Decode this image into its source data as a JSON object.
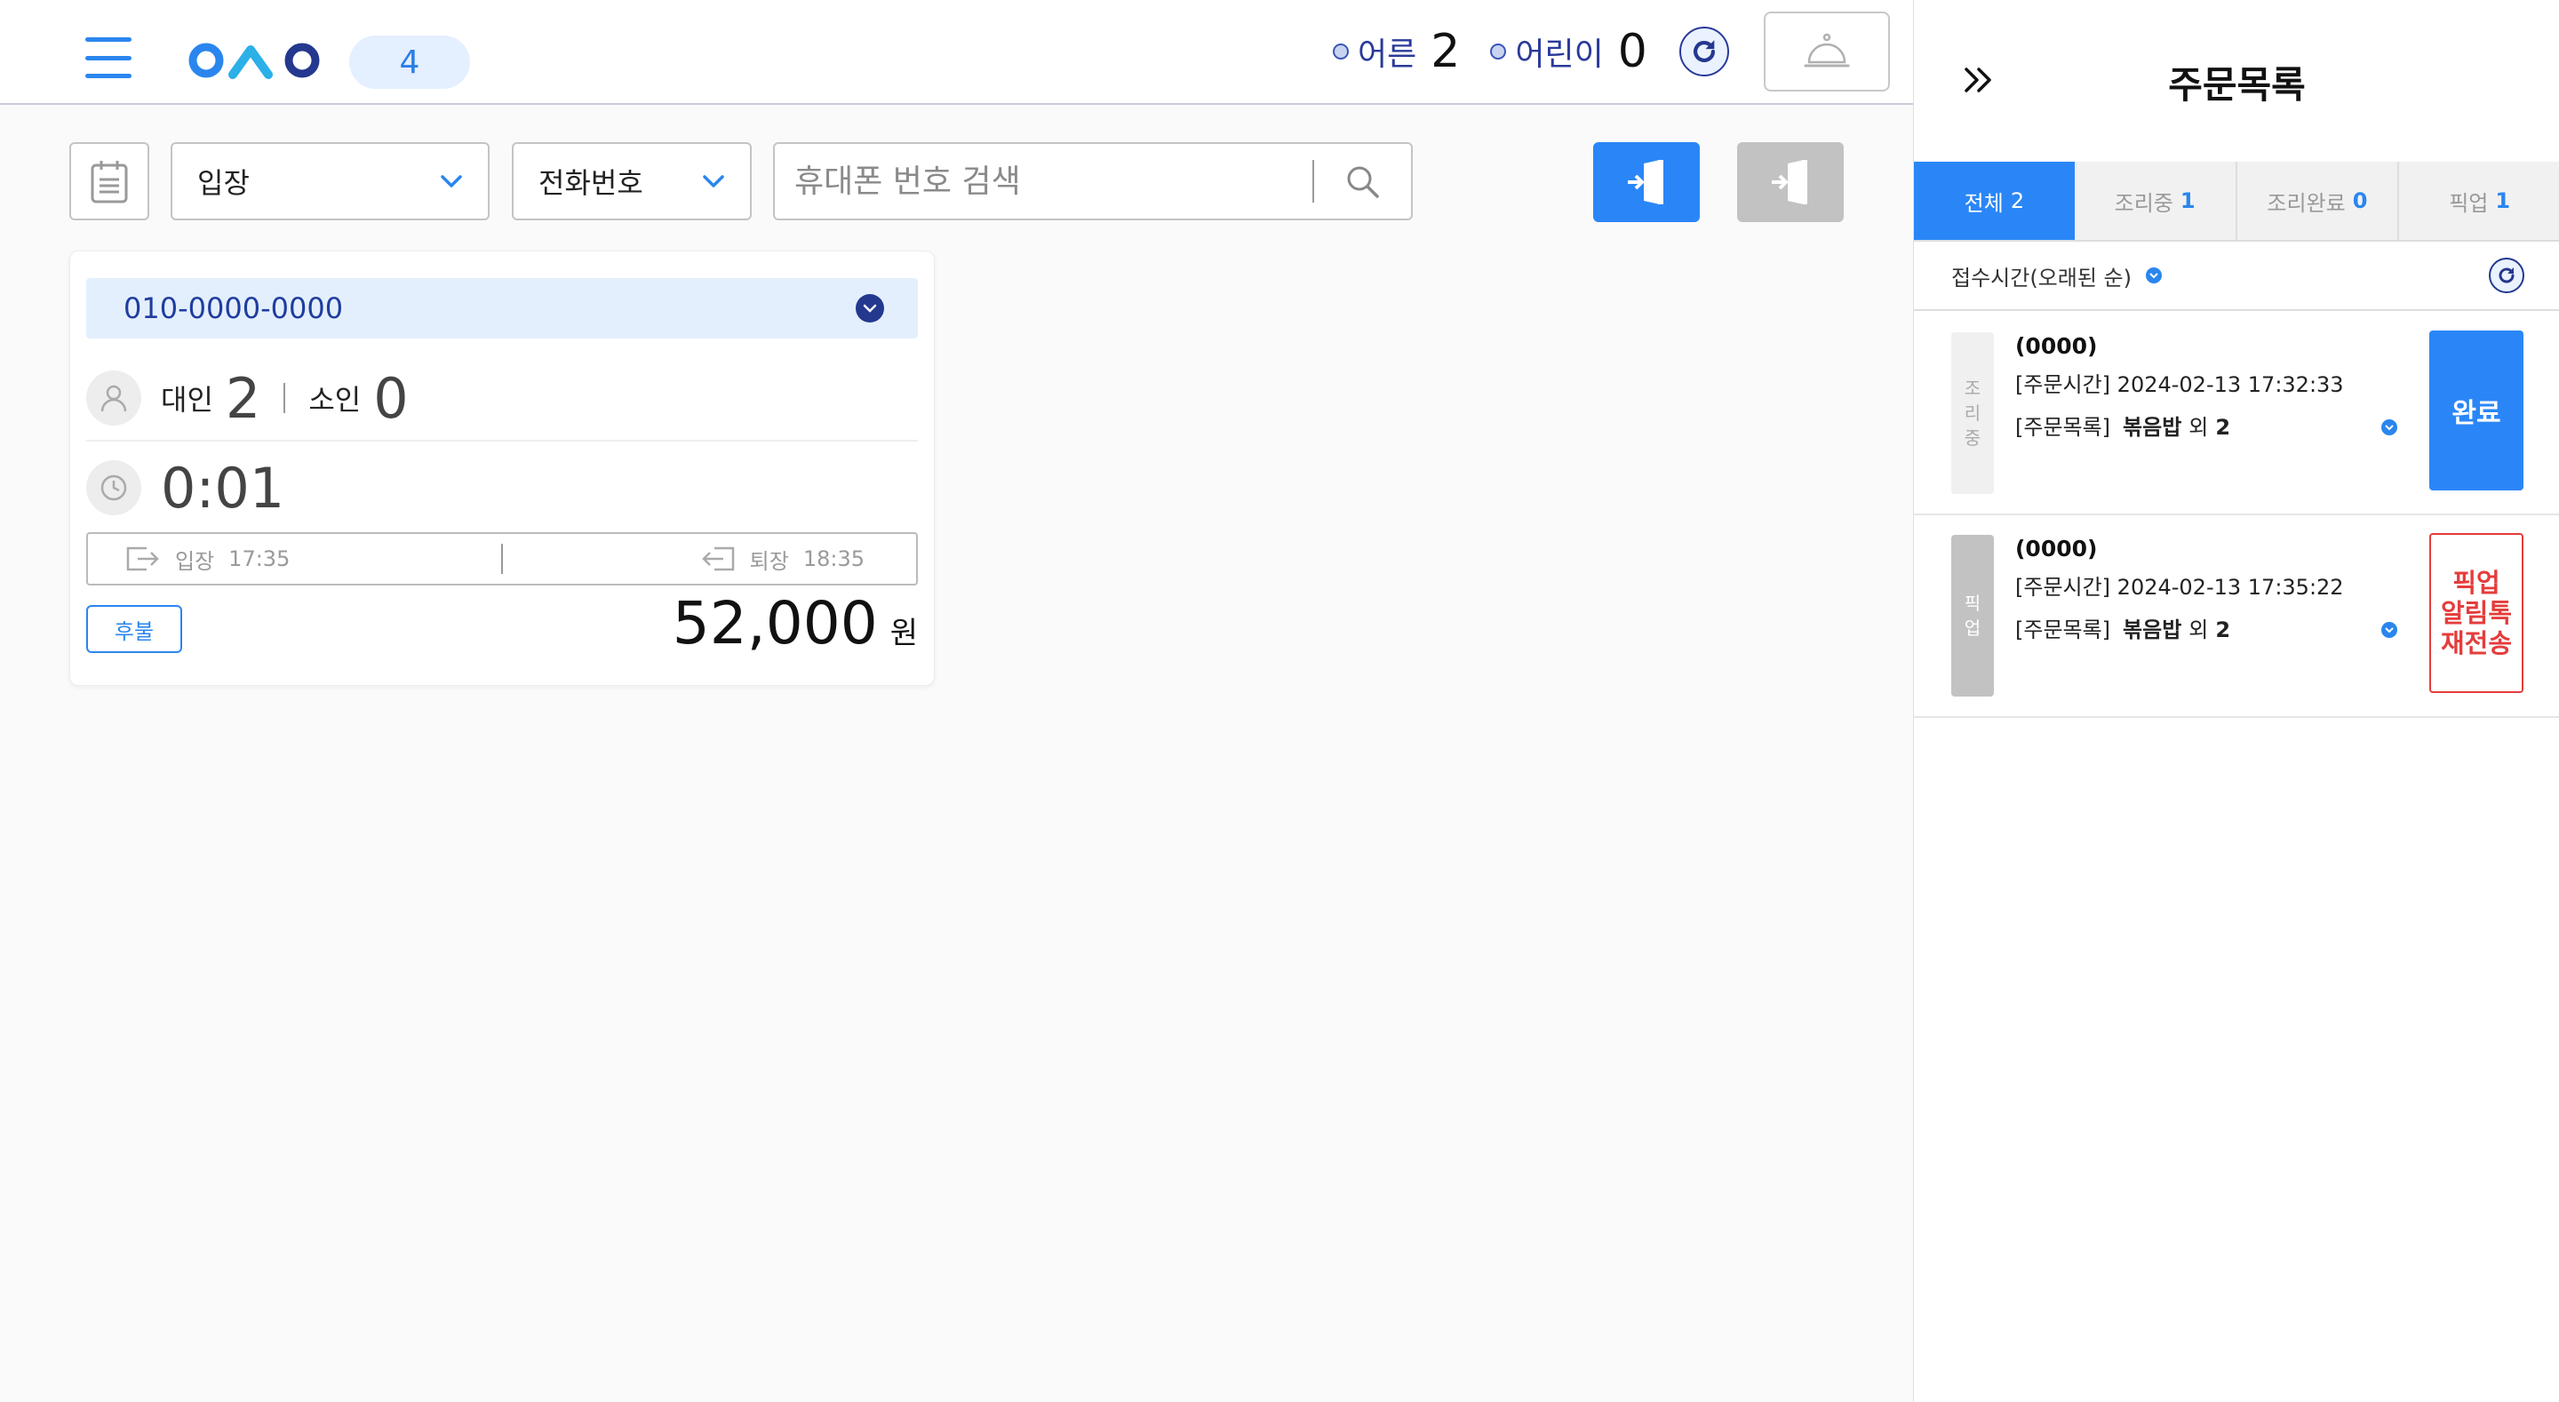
{
  "header": {
    "badge_count": "4",
    "adult_label": "어른",
    "adult_count": "2",
    "child_label": "어린이",
    "child_count": "0"
  },
  "toolbar": {
    "entry_select": "입장",
    "phone_select": "전화번호",
    "search_placeholder": "휴대폰 번호 검색"
  },
  "card": {
    "phone": "010-0000-0000",
    "adult_label": "대인",
    "adult_count": "2",
    "child_label": "소인",
    "child_count": "0",
    "elapsed": "0:01",
    "entry_label": "입장",
    "entry_time": "17:35",
    "exit_label": "퇴장",
    "exit_time": "18:35",
    "payment_badge": "후불",
    "amount": "52,000",
    "amount_unit": "원"
  },
  "panel": {
    "title": "주문목록",
    "tabs": [
      {
        "label": "전체",
        "count": "2"
      },
      {
        "label": "조리중",
        "count": "1"
      },
      {
        "label": "조리완료",
        "count": "0"
      },
      {
        "label": "픽업",
        "count": "1"
      }
    ],
    "sort_label": "접수시간(오래된 순)",
    "orders": [
      {
        "status": [
          "조",
          "리",
          "중"
        ],
        "id": "(0000)",
        "time": "[주문시간] 2024-02-13 17:32:33",
        "menu_prefix": "[주문목록]",
        "menu_item": "볶음밥",
        "menu_more": "외",
        "menu_count": "2",
        "action": "완료"
      },
      {
        "status": [
          "픽",
          "업"
        ],
        "id": "(0000)",
        "time": "[주문시간] 2024-02-13 17:35:22",
        "menu_prefix": "[주문목록]",
        "menu_item": "볶음밥",
        "menu_more": "외",
        "menu_count": "2",
        "action_lines": [
          "픽업",
          "알림톡",
          "재전송"
        ]
      }
    ]
  },
  "colors": {
    "accent": "#2a86f7",
    "navy": "#24388f",
    "alert_red": "#e53c3c",
    "muted_gray": "#c2c2c2"
  },
  "icons": [
    "hamburger-icon",
    "refresh-icon",
    "bell-icon",
    "calendar-icon",
    "chevron-down-icon",
    "search-icon",
    "door-enter-icon",
    "door-exit-icon",
    "user-icon",
    "clock-icon",
    "double-chevron-right-icon"
  ]
}
